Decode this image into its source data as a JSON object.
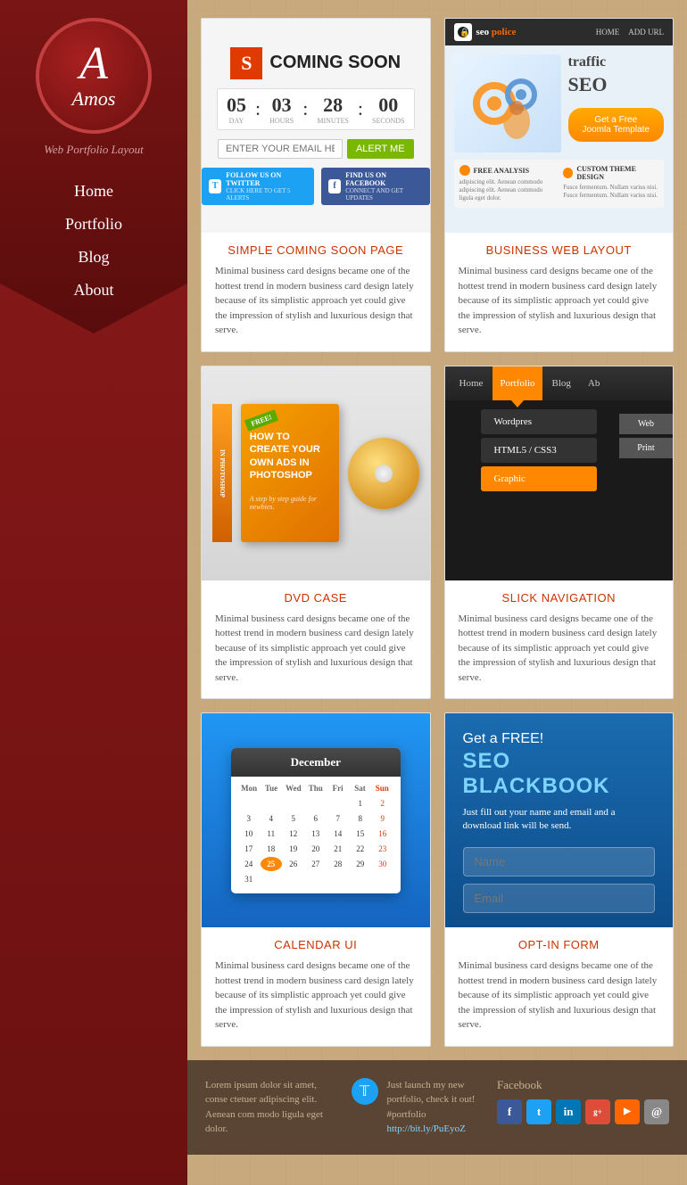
{
  "sidebar": {
    "logo_letter": "A",
    "logo_name": "Amos",
    "subtitle": "Web Portfolio Layout",
    "nav": [
      {
        "label": "Home",
        "href": "#"
      },
      {
        "label": "Portfolio",
        "href": "#"
      },
      {
        "label": "Blog",
        "href": "#"
      },
      {
        "label": "About",
        "href": "#"
      }
    ]
  },
  "portfolio": {
    "row1": [
      {
        "title": "SIMPLE COMING SOON PAGE",
        "desc": "Minimal business card designs became one of the hottest trend in modern business card design lately because of its simplistic approach yet could give the impression of stylish and luxurious design that serve.",
        "countdown": {
          "days": "05",
          "hours": "03",
          "minutes": "28",
          "seconds": "00"
        },
        "input_placeholder": "ENTER YOUR EMAIL HERE...",
        "btn_label": "ALERT ME",
        "twitter_text": "FOLLOW US ON TWITTER",
        "twitter_sub": "CLICK HERE TO GET 5 ALERTS",
        "fb_text": "FIND US ON FACEBOOK",
        "fb_sub": "CONNECT AND GET UPDATES"
      },
      {
        "title": "BUSINESS WEB LAYOUT",
        "desc": "Minimal business card designs became one of the hottest trend in modern business card design lately because of its simplistic approach yet could give the impression of stylish and luxurious design that serve.",
        "seo_title": "SEO POLICE",
        "traffic_text": "traffic",
        "seo_text": "SEO",
        "btn_label": "Get a Free Joomla Template",
        "bottom1_title": "FREE ANALYSIS",
        "bottom1_text": "adipiscing elit. Aenean commodo adipiscing elit. Aenean commodo ligula eget dolor.",
        "bottom2_title": "CUSTOM THEME DESIGN",
        "bottom2_text": "Fusce fermentum. Nullam varius nisi. Fusce fermentum. Nullam varius nisi."
      }
    ],
    "row2": [
      {
        "title": "DVD CASE",
        "desc": "Minimal business card designs became one of the hottest trend in modern business card design lately because of its simplistic approach yet could give the impression of stylish and luxurious design that serve.",
        "free_badge": "FREE!",
        "book_title": "HOW TO CREATE YOUR OWN ADS IN PHOTOSHOP",
        "book_sub": "A step by step guide for newbies.",
        "spine_text": "IN PHOTOSHOP"
      },
      {
        "title": "SLICK NAVIGATION",
        "desc": "Minimal business card designs became one of the hottest trend in modern business card design lately because of its simplistic approach yet could give the impression of stylish and luxurious design that serve.",
        "nav_items": [
          "Home",
          "Portfolio",
          "Blog",
          "Ab"
        ],
        "dropdown_items": [
          "Wordpres",
          "HTML5 / CSS3",
          "Graphic"
        ],
        "side_items": [
          "Web",
          "Print"
        ]
      }
    ],
    "row3": [
      {
        "title": "CALENDAR UI",
        "desc": "Minimal business card designs became one of the hottest trend in modern business card design lately because of its simplistic approach yet could give the impression of stylish and luxurious design that serve.",
        "month": "December",
        "day_names": [
          "Mon",
          "Tue",
          "Wed",
          "Thu",
          "Fri",
          "Sat",
          "Sun"
        ],
        "weeks": [
          [
            "",
            "",
            "",
            "",
            "",
            "1",
            "2",
            "3",
            "4"
          ],
          [
            "5",
            "6",
            "7",
            "8",
            "9",
            "10",
            "11"
          ],
          [
            "12",
            "13",
            "14",
            "15",
            "16",
            "17",
            "18"
          ],
          [
            "19",
            "20",
            "21",
            "22",
            "23",
            "24",
            "25"
          ],
          [
            "26",
            "27",
            "28",
            "29",
            "30",
            "31",
            ""
          ]
        ],
        "today": "25"
      },
      {
        "title": "OPT-IN FORM",
        "desc": "Minimal business card designs became one of the hottest trend in modern business card design lately because of its simplistic approach yet could give the impression of stylish and luxurious design that serve.",
        "get_label": "Get a FREE!",
        "main_title": "SEO BLACKBOOK",
        "sub_text": "Just fill out your name and email and a download link will be send.",
        "name_placeholder": "Name",
        "email_placeholder": "Email"
      }
    ]
  },
  "footer": {
    "lorem": "Lorem ipsum dolor sit amet, conse ctetuer adipiscing elit. Aenean com modo ligula eget dolor.",
    "tweet": "Just launch my new portfolio, check it out! #portfolio",
    "tweet_link": "http://bit.ly/PuEyoZ",
    "fb_label": "Facebook",
    "social_icons": [
      "f",
      "t",
      "in",
      "g+",
      "rss",
      "@"
    ]
  }
}
